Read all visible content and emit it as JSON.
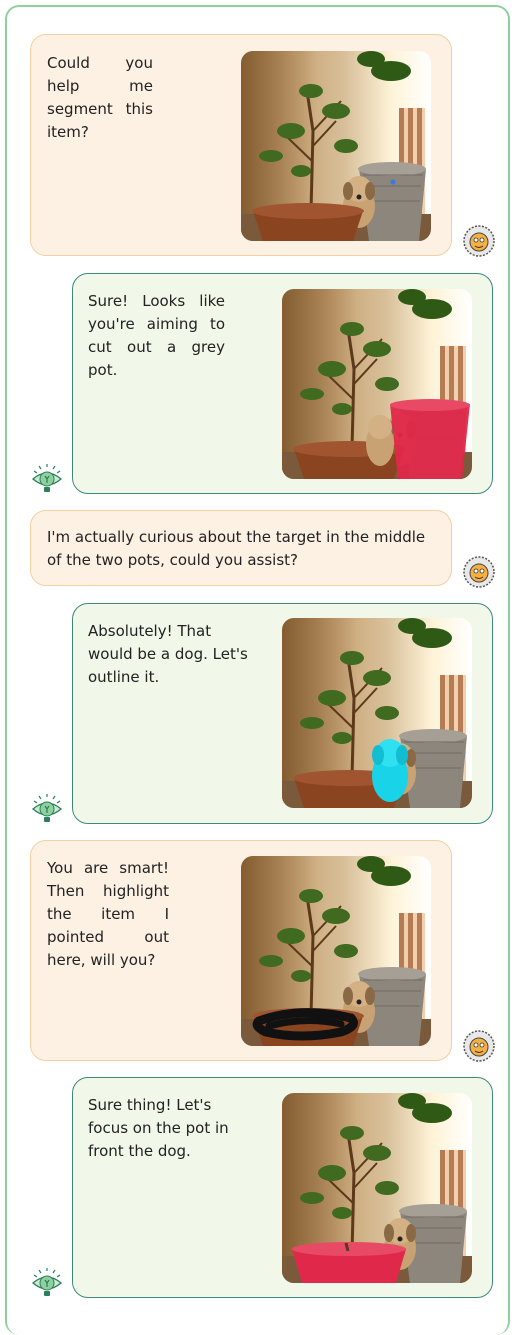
{
  "messages": [
    {
      "role": "user",
      "text": "Could you help me segment this item?"
    },
    {
      "role": "assistant",
      "text": "Sure! Looks like you're aiming to cut out a grey pot."
    },
    {
      "role": "user",
      "text": "I'm actually curious about the target in the middle of the two pots, could you assist?"
    },
    {
      "role": "assistant",
      "text": "Absolutely! That would be a dog. Let's outline it."
    },
    {
      "role": "user",
      "text": "You are smart! Then highlight the item I pointed out here, will you?"
    },
    {
      "role": "assistant",
      "text": "Sure thing! Let's focus on the pot in front the dog."
    }
  ],
  "colors": {
    "user_bubble_bg": "#fdf1e4",
    "user_bubble_border": "#f3cfa3",
    "bot_bubble_bg": "#f1f8e9",
    "bot_bubble_border": "#3d8a78",
    "frame_border": "#8fd19e",
    "mask_red": "#e0284a",
    "mask_cyan": "#19d3e8",
    "scribble": "#111111"
  },
  "icons": {
    "user_avatar": "user-avatar-icon",
    "bot_avatar": "lightbulb-eye-icon"
  }
}
